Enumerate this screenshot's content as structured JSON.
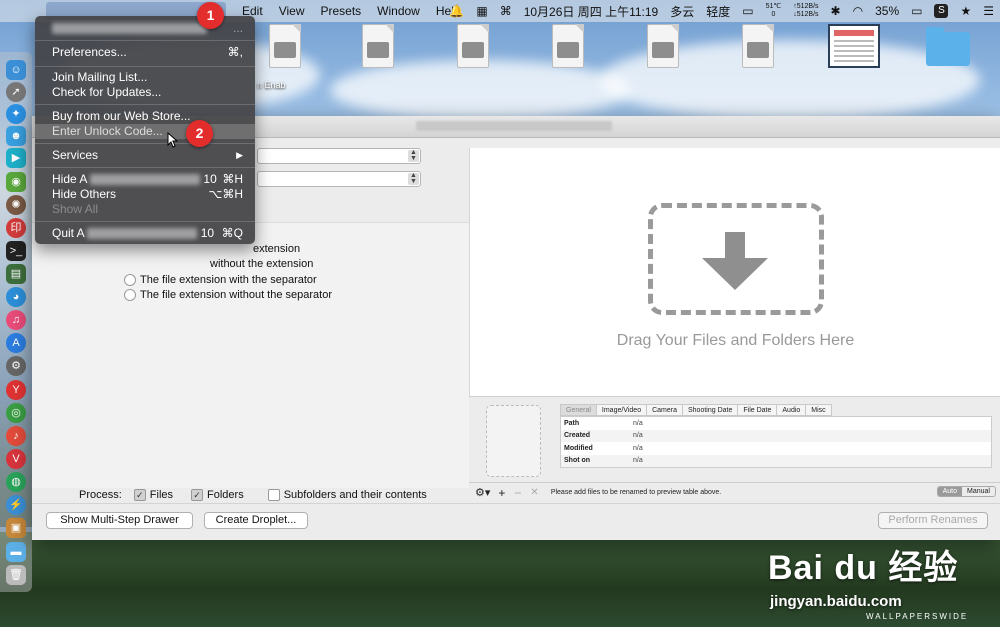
{
  "menubar": {
    "apple_symbol": "",
    "items": [
      "Edit",
      "View",
      "Presets",
      "Window",
      "Help"
    ],
    "clock": "10月26日 周四 上午11:19",
    "weather": "多云",
    "air": "轻度",
    "temp": "51℃",
    "temp2": "0",
    "net_up": "↑512B/s",
    "net_down": "↓512B/s",
    "battery": "35%",
    "status_icons": [
      "bell-icon",
      "layout-icon",
      "command-icon",
      "bluetooth-icon",
      "wifi-icon",
      "battery-icon",
      "spotlight-icon",
      "star-icon",
      "list-icon"
    ]
  },
  "desktop": {
    "fragment_label": "n Enab"
  },
  "app_menu": {
    "header": "About A Better Finder Rename...",
    "items": [
      {
        "label": "Preferences...",
        "shortcut": "⌘,"
      },
      {
        "label": "Join Mailing List...",
        "shortcut": ""
      },
      {
        "label": "Check for Updates...",
        "shortcut": ""
      },
      {
        "label": "Buy from our Web Store...",
        "shortcut": ""
      },
      {
        "label": "Enter Unlock Code...",
        "shortcut": ""
      },
      {
        "label": "Services",
        "shortcut": "▶"
      },
      {
        "label": "Hide A",
        "suffix": "10",
        "shortcut": "⌘H"
      },
      {
        "label": "Hide Others",
        "shortcut": "⌥⌘H"
      },
      {
        "label": "Show All",
        "shortcut": ""
      },
      {
        "label": "Quit A",
        "suffix": "10",
        "shortcut": "⌘Q"
      }
    ]
  },
  "annotations": {
    "one": "1",
    "two": "2"
  },
  "left_pane": {
    "radio_options": [
      "extension",
      "without the extension",
      "The file extension with the separator",
      "The file extension without the separator"
    ]
  },
  "process": {
    "label": "Process:",
    "files": "Files",
    "folders": "Folders",
    "subfolders": "Subfolders and their contents",
    "files_checked": true,
    "folders_checked": true,
    "subfolders_checked": false
  },
  "drop": {
    "text": "Drag Your Files and Folders Here"
  },
  "info": {
    "tabs": [
      "General",
      "Image/Video",
      "Camera",
      "Shooting Date",
      "File Date",
      "Audio",
      "Misc"
    ],
    "rows": [
      {
        "key": "Path",
        "value": "n/a"
      },
      {
        "key": "Created",
        "value": "n/a"
      },
      {
        "key": "Modified",
        "value": "n/a"
      },
      {
        "key": "Shot on",
        "value": "n/a"
      }
    ]
  },
  "bottom_bar": {
    "message": "Please add files to be renamed to preview table above.",
    "auto": "Auto",
    "manual": "Manual"
  },
  "footer": {
    "multi_step": "Show Multi-Step Drawer",
    "droplet": "Create Droplet...",
    "perform": "Perform Renames"
  },
  "watermark": {
    "brand": "Bai du 经验",
    "url": "jingyan.baidu.com",
    "wp": "WALLPAPERSWIDE"
  }
}
